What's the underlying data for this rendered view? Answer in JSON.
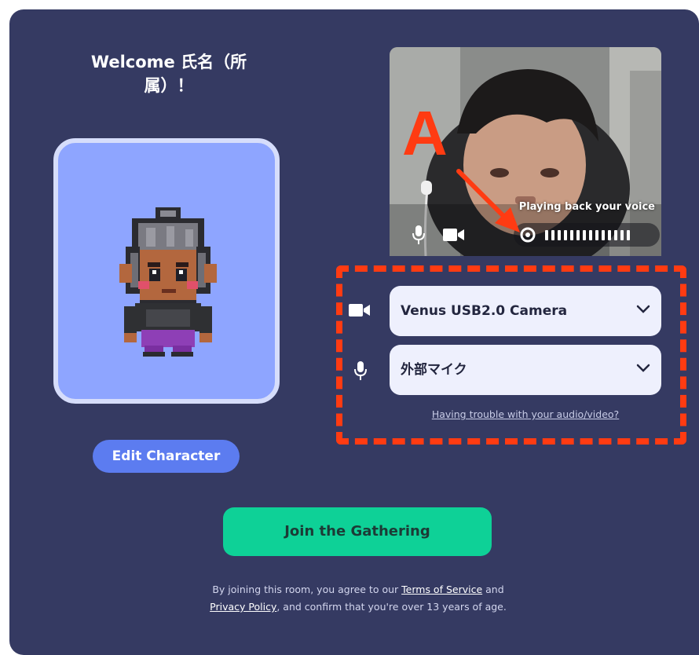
{
  "welcome": {
    "line1": "Welcome 氏名（所",
    "line2": "属）！"
  },
  "avatar": {
    "edit_label": "Edit Character",
    "card_color": "#8ea5ff"
  },
  "video": {
    "playback_text": "Playing back your voice",
    "controls": {
      "mic_icon": "microphone-icon",
      "camera_icon": "video-camera-icon",
      "record_icon": "record-icon"
    }
  },
  "annotation": {
    "label": "A",
    "color": "#ff3b12"
  },
  "devices": {
    "camera": {
      "icon": "video-camera-icon",
      "selected": "Venus USB2.0 Camera"
    },
    "microphone": {
      "icon": "microphone-icon",
      "selected": "外部マイク"
    },
    "trouble_link": "Having trouble with your audio/video?"
  },
  "join": {
    "label": "Join the Gathering",
    "color": "#0ed197"
  },
  "legal": {
    "prefix": "By joining this room, you agree to our ",
    "terms": "Terms of Service",
    "and": " and",
    "privacy": "Privacy Policy",
    "suffix": ", and confirm that you're over 13 years of age."
  },
  "colors": {
    "panel": "#353a62",
    "accent_blue": "#5c7cf0"
  }
}
